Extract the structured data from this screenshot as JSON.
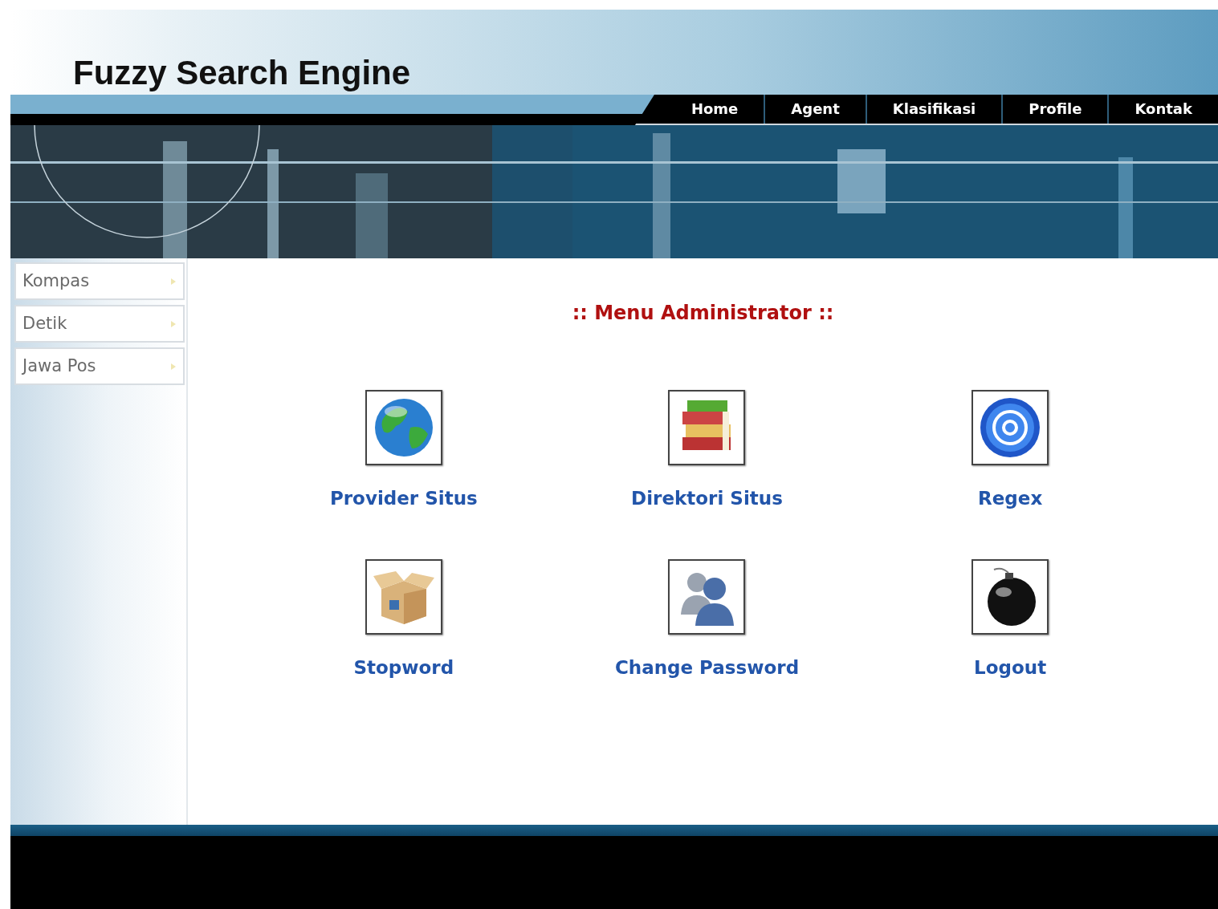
{
  "header": {
    "title": "Fuzzy Search Engine"
  },
  "nav": [
    {
      "label": "Home"
    },
    {
      "label": "Agent"
    },
    {
      "label": "Klasifikasi"
    },
    {
      "label": "Profile"
    },
    {
      "label": "Kontak"
    }
  ],
  "sidebar": {
    "items": [
      {
        "label": "Kompas"
      },
      {
        "label": "Detik"
      },
      {
        "label": "Jawa Pos"
      }
    ]
  },
  "main": {
    "heading": ":: Menu Administrator ::",
    "menu": [
      {
        "label": "Provider Situs",
        "kind": "globe"
      },
      {
        "label": "Direktori Situs",
        "kind": "books"
      },
      {
        "label": "Regex",
        "kind": "at"
      },
      {
        "label": "Stopword",
        "kind": "box"
      },
      {
        "label": "Change Password",
        "kind": "users"
      },
      {
        "label": "Logout",
        "kind": "bomb"
      }
    ]
  }
}
